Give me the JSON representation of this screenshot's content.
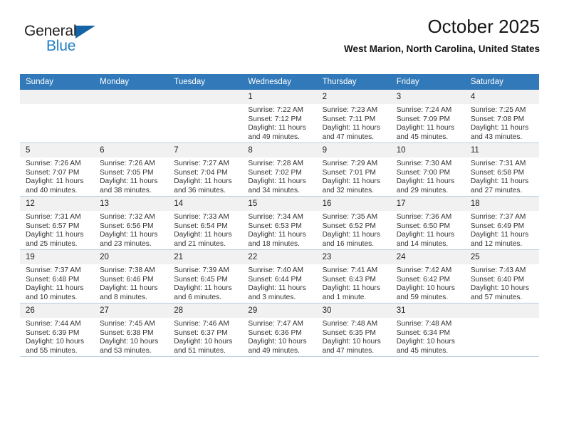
{
  "brand": {
    "name_top": "General",
    "name_bottom": "Blue"
  },
  "header": {
    "title": "October 2025",
    "subtitle": "West Marion, North Carolina, United States"
  },
  "colors": {
    "header_blue": "#3179b8",
    "logo_blue": "#1f7dc4",
    "daynum_gray": "#f1f1f1",
    "grid_line": "#b9cde0"
  },
  "weekdays": [
    "Sunday",
    "Monday",
    "Tuesday",
    "Wednesday",
    "Thursday",
    "Friday",
    "Saturday"
  ],
  "labels": {
    "sunrise": "Sunrise:",
    "sunset": "Sunset:",
    "daylight": "Daylight:"
  },
  "weeks": [
    [
      {
        "day": "",
        "sunrise": "",
        "sunset": "",
        "daylight_1": "",
        "daylight_2": ""
      },
      {
        "day": "",
        "sunrise": "",
        "sunset": "",
        "daylight_1": "",
        "daylight_2": ""
      },
      {
        "day": "",
        "sunrise": "",
        "sunset": "",
        "daylight_1": "",
        "daylight_2": ""
      },
      {
        "day": "1",
        "sunrise": "Sunrise: 7:22 AM",
        "sunset": "Sunset: 7:12 PM",
        "daylight_1": "Daylight: 11 hours",
        "daylight_2": "and 49 minutes."
      },
      {
        "day": "2",
        "sunrise": "Sunrise: 7:23 AM",
        "sunset": "Sunset: 7:11 PM",
        "daylight_1": "Daylight: 11 hours",
        "daylight_2": "and 47 minutes."
      },
      {
        "day": "3",
        "sunrise": "Sunrise: 7:24 AM",
        "sunset": "Sunset: 7:09 PM",
        "daylight_1": "Daylight: 11 hours",
        "daylight_2": "and 45 minutes."
      },
      {
        "day": "4",
        "sunrise": "Sunrise: 7:25 AM",
        "sunset": "Sunset: 7:08 PM",
        "daylight_1": "Daylight: 11 hours",
        "daylight_2": "and 43 minutes."
      }
    ],
    [
      {
        "day": "5",
        "sunrise": "Sunrise: 7:26 AM",
        "sunset": "Sunset: 7:07 PM",
        "daylight_1": "Daylight: 11 hours",
        "daylight_2": "and 40 minutes."
      },
      {
        "day": "6",
        "sunrise": "Sunrise: 7:26 AM",
        "sunset": "Sunset: 7:05 PM",
        "daylight_1": "Daylight: 11 hours",
        "daylight_2": "and 38 minutes."
      },
      {
        "day": "7",
        "sunrise": "Sunrise: 7:27 AM",
        "sunset": "Sunset: 7:04 PM",
        "daylight_1": "Daylight: 11 hours",
        "daylight_2": "and 36 minutes."
      },
      {
        "day": "8",
        "sunrise": "Sunrise: 7:28 AM",
        "sunset": "Sunset: 7:02 PM",
        "daylight_1": "Daylight: 11 hours",
        "daylight_2": "and 34 minutes."
      },
      {
        "day": "9",
        "sunrise": "Sunrise: 7:29 AM",
        "sunset": "Sunset: 7:01 PM",
        "daylight_1": "Daylight: 11 hours",
        "daylight_2": "and 32 minutes."
      },
      {
        "day": "10",
        "sunrise": "Sunrise: 7:30 AM",
        "sunset": "Sunset: 7:00 PM",
        "daylight_1": "Daylight: 11 hours",
        "daylight_2": "and 29 minutes."
      },
      {
        "day": "11",
        "sunrise": "Sunrise: 7:31 AM",
        "sunset": "Sunset: 6:58 PM",
        "daylight_1": "Daylight: 11 hours",
        "daylight_2": "and 27 minutes."
      }
    ],
    [
      {
        "day": "12",
        "sunrise": "Sunrise: 7:31 AM",
        "sunset": "Sunset: 6:57 PM",
        "daylight_1": "Daylight: 11 hours",
        "daylight_2": "and 25 minutes."
      },
      {
        "day": "13",
        "sunrise": "Sunrise: 7:32 AM",
        "sunset": "Sunset: 6:56 PM",
        "daylight_1": "Daylight: 11 hours",
        "daylight_2": "and 23 minutes."
      },
      {
        "day": "14",
        "sunrise": "Sunrise: 7:33 AM",
        "sunset": "Sunset: 6:54 PM",
        "daylight_1": "Daylight: 11 hours",
        "daylight_2": "and 21 minutes."
      },
      {
        "day": "15",
        "sunrise": "Sunrise: 7:34 AM",
        "sunset": "Sunset: 6:53 PM",
        "daylight_1": "Daylight: 11 hours",
        "daylight_2": "and 18 minutes."
      },
      {
        "day": "16",
        "sunrise": "Sunrise: 7:35 AM",
        "sunset": "Sunset: 6:52 PM",
        "daylight_1": "Daylight: 11 hours",
        "daylight_2": "and 16 minutes."
      },
      {
        "day": "17",
        "sunrise": "Sunrise: 7:36 AM",
        "sunset": "Sunset: 6:50 PM",
        "daylight_1": "Daylight: 11 hours",
        "daylight_2": "and 14 minutes."
      },
      {
        "day": "18",
        "sunrise": "Sunrise: 7:37 AM",
        "sunset": "Sunset: 6:49 PM",
        "daylight_1": "Daylight: 11 hours",
        "daylight_2": "and 12 minutes."
      }
    ],
    [
      {
        "day": "19",
        "sunrise": "Sunrise: 7:37 AM",
        "sunset": "Sunset: 6:48 PM",
        "daylight_1": "Daylight: 11 hours",
        "daylight_2": "and 10 minutes."
      },
      {
        "day": "20",
        "sunrise": "Sunrise: 7:38 AM",
        "sunset": "Sunset: 6:46 PM",
        "daylight_1": "Daylight: 11 hours",
        "daylight_2": "and 8 minutes."
      },
      {
        "day": "21",
        "sunrise": "Sunrise: 7:39 AM",
        "sunset": "Sunset: 6:45 PM",
        "daylight_1": "Daylight: 11 hours",
        "daylight_2": "and 6 minutes."
      },
      {
        "day": "22",
        "sunrise": "Sunrise: 7:40 AM",
        "sunset": "Sunset: 6:44 PM",
        "daylight_1": "Daylight: 11 hours",
        "daylight_2": "and 3 minutes."
      },
      {
        "day": "23",
        "sunrise": "Sunrise: 7:41 AM",
        "sunset": "Sunset: 6:43 PM",
        "daylight_1": "Daylight: 11 hours",
        "daylight_2": "and 1 minute."
      },
      {
        "day": "24",
        "sunrise": "Sunrise: 7:42 AM",
        "sunset": "Sunset: 6:42 PM",
        "daylight_1": "Daylight: 10 hours",
        "daylight_2": "and 59 minutes."
      },
      {
        "day": "25",
        "sunrise": "Sunrise: 7:43 AM",
        "sunset": "Sunset: 6:40 PM",
        "daylight_1": "Daylight: 10 hours",
        "daylight_2": "and 57 minutes."
      }
    ],
    [
      {
        "day": "26",
        "sunrise": "Sunrise: 7:44 AM",
        "sunset": "Sunset: 6:39 PM",
        "daylight_1": "Daylight: 10 hours",
        "daylight_2": "and 55 minutes."
      },
      {
        "day": "27",
        "sunrise": "Sunrise: 7:45 AM",
        "sunset": "Sunset: 6:38 PM",
        "daylight_1": "Daylight: 10 hours",
        "daylight_2": "and 53 minutes."
      },
      {
        "day": "28",
        "sunrise": "Sunrise: 7:46 AM",
        "sunset": "Sunset: 6:37 PM",
        "daylight_1": "Daylight: 10 hours",
        "daylight_2": "and 51 minutes."
      },
      {
        "day": "29",
        "sunrise": "Sunrise: 7:47 AM",
        "sunset": "Sunset: 6:36 PM",
        "daylight_1": "Daylight: 10 hours",
        "daylight_2": "and 49 minutes."
      },
      {
        "day": "30",
        "sunrise": "Sunrise: 7:48 AM",
        "sunset": "Sunset: 6:35 PM",
        "daylight_1": "Daylight: 10 hours",
        "daylight_2": "and 47 minutes."
      },
      {
        "day": "31",
        "sunrise": "Sunrise: 7:48 AM",
        "sunset": "Sunset: 6:34 PM",
        "daylight_1": "Daylight: 10 hours",
        "daylight_2": "and 45 minutes."
      },
      {
        "day": "",
        "sunrise": "",
        "sunset": "",
        "daylight_1": "",
        "daylight_2": ""
      }
    ]
  ]
}
